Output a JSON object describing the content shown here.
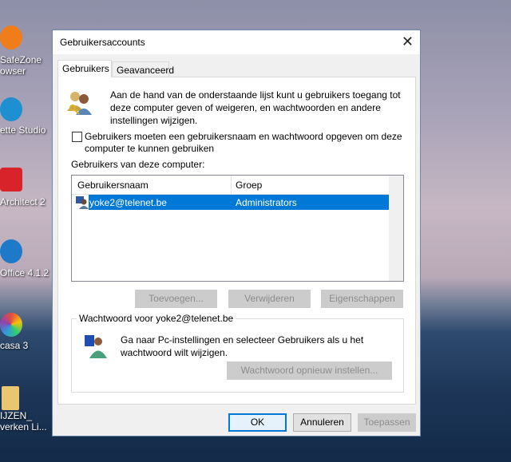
{
  "desktop": {
    "icons": [
      {
        "label1": "SafeZone",
        "label2": "owser",
        "color": "#f07d1a"
      },
      {
        "label1": "ette Studio",
        "color": "#1e8fd0"
      },
      {
        "label1": "Architect 2",
        "color": "#d8232a"
      },
      {
        "label1": "Office 4.1.2",
        "color": "#1e7ac8"
      },
      {
        "label1": "casa 3",
        "color": "#8e44ad"
      },
      {
        "label1": "IJZEN_",
        "label2": "verken Li...",
        "color": "#e8c770"
      }
    ]
  },
  "dialog": {
    "title": "Gebruikersaccounts",
    "close_icon": "close-icon",
    "tabs": [
      {
        "label": "Gebruikers",
        "active": true
      },
      {
        "label": "Geavanceerd",
        "active": false
      }
    ],
    "description": [
      "Aan de hand van de onderstaande lijst kunt u gebruikers toegang tot",
      "deze computer geven of weigeren, en wachtwoorden en andere",
      "instellingen wijzigen."
    ],
    "checkbox": {
      "checked": false,
      "lines": [
        "Gebruikers moeten een gebruikersnaam en wachtwoord opgeven om deze",
        "computer te kunnen gebruiken"
      ]
    },
    "users_label": "Gebruikers van deze computer:",
    "table": {
      "columns": [
        "Gebruikersnaam",
        "Groep"
      ],
      "rows": [
        {
          "name": "yoke2@telenet.be",
          "group": "Administrators",
          "selected": true
        }
      ]
    },
    "buttons": {
      "add": "Toevoegen...",
      "remove": "Verwijderen",
      "properties": "Eigenschappen"
    },
    "password_group": {
      "legend": "Wachtwoord voor yoke2@telenet.be",
      "text": [
        "Ga naar Pc-instellingen en selecteer Gebruikers als u het",
        "wachtwoord wilt wijzigen."
      ],
      "reset": "Wachtwoord opnieuw instellen..."
    },
    "footer": {
      "ok": "OK",
      "cancel": "Annuleren",
      "apply": "Toepassen"
    },
    "accent": "#0078d7"
  }
}
